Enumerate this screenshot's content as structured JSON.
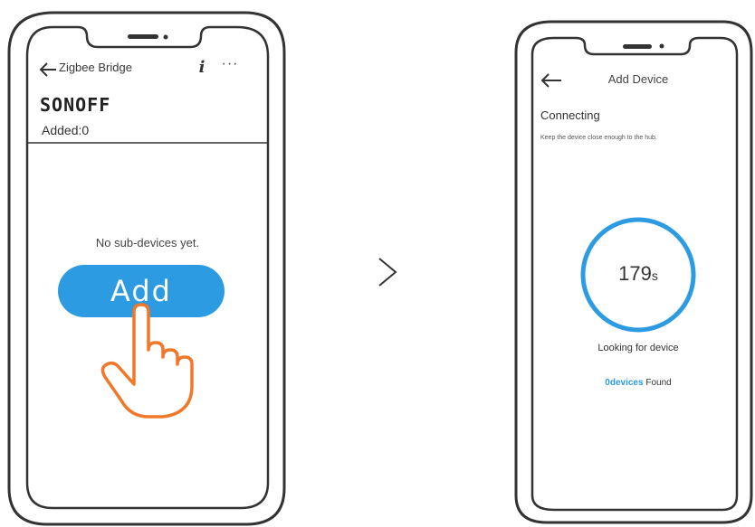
{
  "left_screen": {
    "title": "Zigbee Bridge",
    "info_glyph": "i",
    "more_glyph": "···",
    "brand_logo": "SONOFF",
    "added_label": "Added:0",
    "empty_message": "No sub-devices yet.",
    "add_button_label": "Add",
    "icons": [
      "back-arrow-icon",
      "info-icon",
      "more-icon",
      "pointing-hand-icon"
    ]
  },
  "navigation_arrow_glyph": "chevron-right-icon",
  "right_screen": {
    "title": "Add Device",
    "status_heading": "Connecting",
    "hint": "Keep the device close enough to the hub.",
    "countdown_value": "179",
    "countdown_unit": "s",
    "looking_label": "Looking for device",
    "devices_found_count": "0devices",
    "devices_found_label": "Found",
    "icons": [
      "back-arrow-icon",
      "countdown-ring-icon"
    ]
  },
  "colors": {
    "accent_blue": "#2c9be2",
    "hand_orange": "#f07828",
    "outline": "#3a3a3a",
    "background": "#ffffff"
  }
}
